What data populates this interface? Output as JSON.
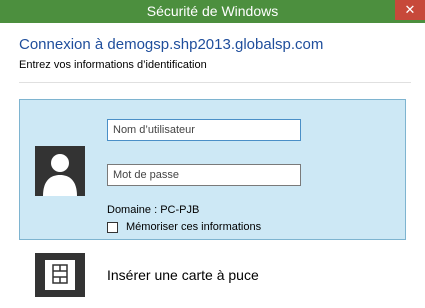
{
  "window": {
    "title": "Sécurité de Windows",
    "close_glyph": "✕"
  },
  "header": {
    "title": "Connexion à demogsp.shp2013.globalsp.com",
    "subtitle": "Entrez vos informations d’identification"
  },
  "credentials": {
    "username_placeholder": "Nom d’utilisateur",
    "username_value": "",
    "password_placeholder": "Mot de passe",
    "password_value": "",
    "domain_text": "Domaine : PC-PJB",
    "remember_label": "Mémoriser ces informations",
    "remember_checked": false
  },
  "smartcard": {
    "label": "Insérer une carte à puce"
  },
  "colors": {
    "titlebar": "#4c8f3e",
    "close_button": "#c7493a",
    "header_title": "#1f4e9c",
    "panel_background": "#cde8f5",
    "panel_border": "#7eb4d0",
    "icon_tile": "#333333"
  },
  "icons": {
    "avatar": "user-avatar-icon",
    "smartcard": "smartcard-icon",
    "close": "close-icon"
  }
}
